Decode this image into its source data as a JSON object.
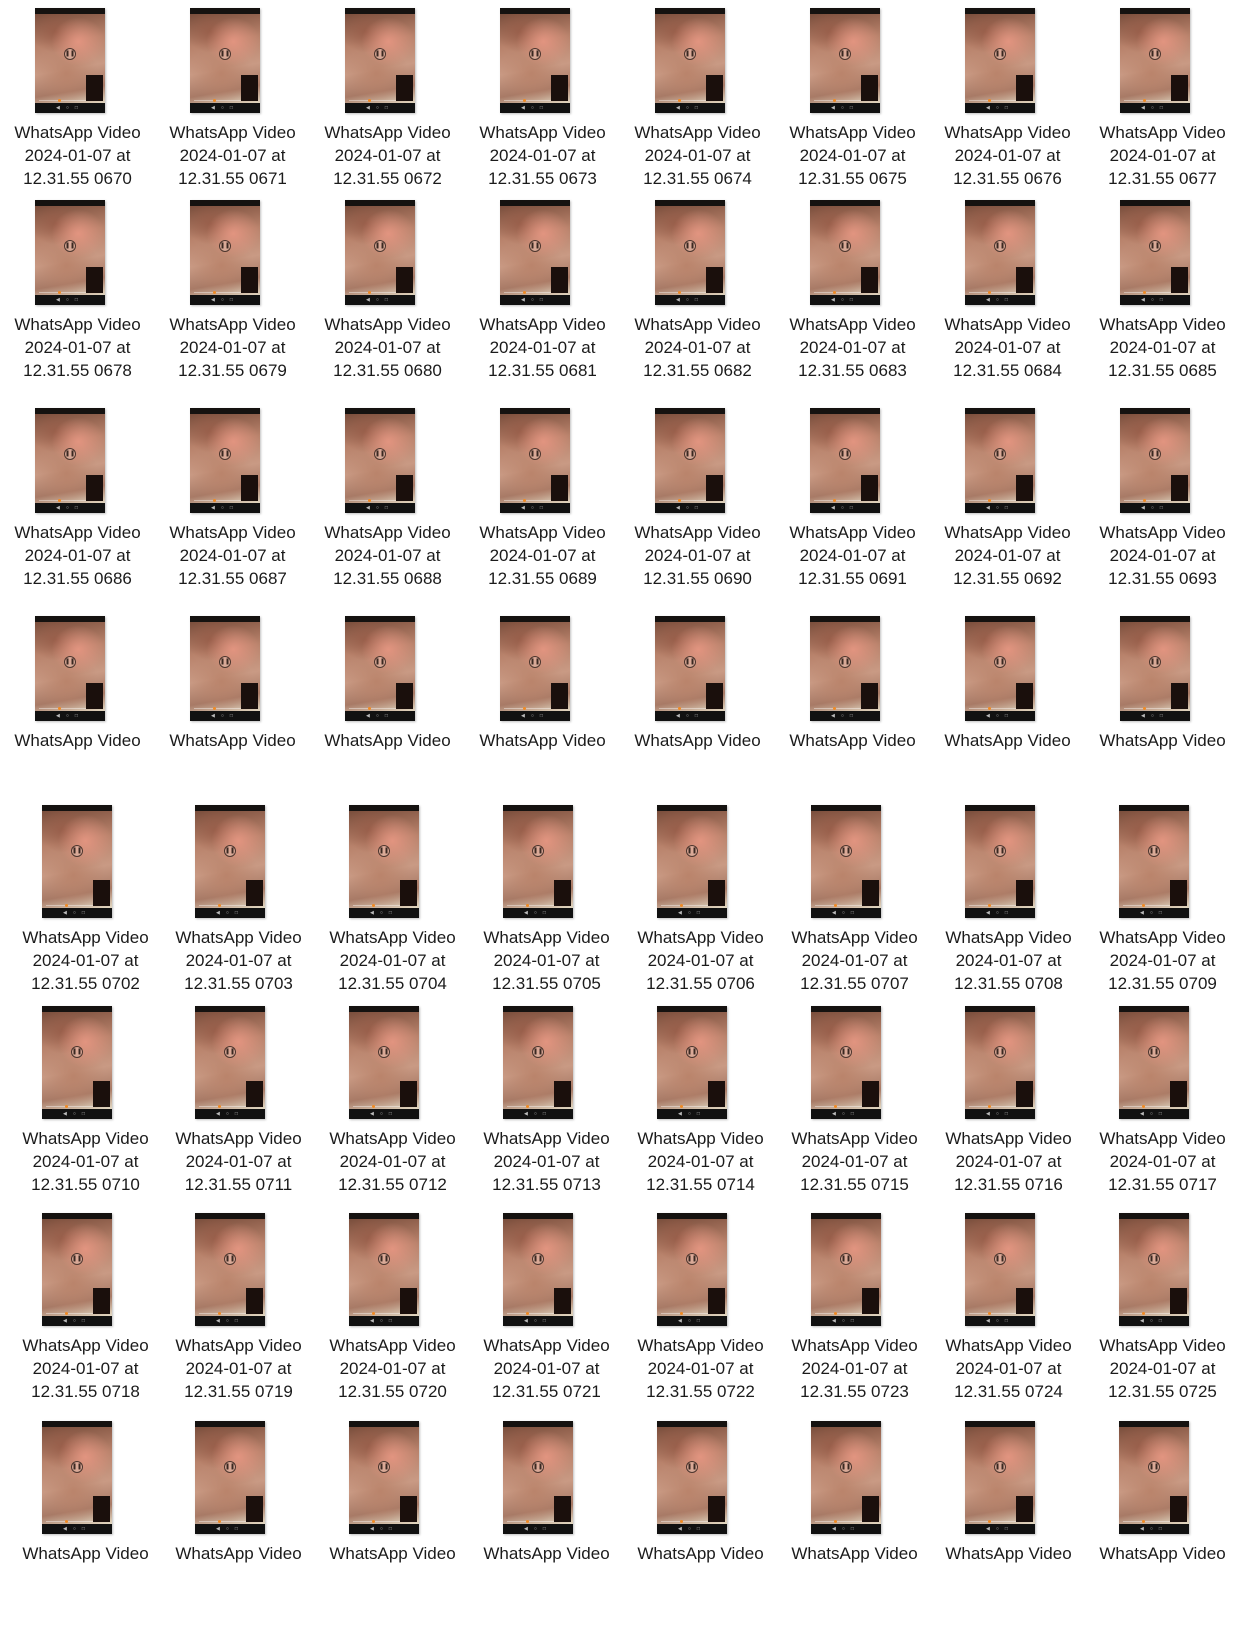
{
  "icon": "video-thumbnail-icon",
  "sections": [
    {
      "rows": [
        {
          "items": [
            [
              "WhatsApp Video",
              "2024-01-07 at",
              "12.31.55 0670"
            ],
            [
              "WhatsApp Video",
              "2024-01-07 at",
              "12.31.55 0671"
            ],
            [
              "WhatsApp Video",
              "2024-01-07 at",
              "12.31.55 0672"
            ],
            [
              "WhatsApp Video",
              "2024-01-07 at",
              "12.31.55 0673"
            ],
            [
              "WhatsApp Video",
              "2024-01-07 at",
              "12.31.55 0674"
            ],
            [
              "WhatsApp Video",
              "2024-01-07 at",
              "12.31.55 0675"
            ],
            [
              "WhatsApp Video",
              "2024-01-07 at",
              "12.31.55 0676"
            ],
            [
              "WhatsApp Video",
              "2024-01-07 at",
              "12.31.55 0677"
            ]
          ]
        },
        {
          "items": [
            [
              "WhatsApp Video",
              "2024-01-07 at",
              "12.31.55 0678"
            ],
            [
              "WhatsApp Video",
              "2024-01-07 at",
              "12.31.55 0679"
            ],
            [
              "WhatsApp Video",
              "2024-01-07 at",
              "12.31.55 0680"
            ],
            [
              "WhatsApp Video",
              "2024-01-07 at",
              "12.31.55 0681"
            ],
            [
              "WhatsApp Video",
              "2024-01-07 at",
              "12.31.55 0682"
            ],
            [
              "WhatsApp Video",
              "2024-01-07 at",
              "12.31.55 0683"
            ],
            [
              "WhatsApp Video",
              "2024-01-07 at",
              "12.31.55 0684"
            ],
            [
              "WhatsApp Video",
              "2024-01-07 at",
              "12.31.55 0685"
            ]
          ]
        },
        {
          "items": [
            [
              "WhatsApp Video",
              "2024-01-07 at",
              "12.31.55 0686"
            ],
            [
              "WhatsApp Video",
              "2024-01-07 at",
              "12.31.55 0687"
            ],
            [
              "WhatsApp Video",
              "2024-01-07 at",
              "12.31.55 0688"
            ],
            [
              "WhatsApp Video",
              "2024-01-07 at",
              "12.31.55 0689"
            ],
            [
              "WhatsApp Video",
              "2024-01-07 at",
              "12.31.55 0690"
            ],
            [
              "WhatsApp Video",
              "2024-01-07 at",
              "12.31.55 0691"
            ],
            [
              "WhatsApp Video",
              "2024-01-07 at",
              "12.31.55 0692"
            ],
            [
              "WhatsApp Video",
              "2024-01-07 at",
              "12.31.55 0693"
            ]
          ]
        },
        {
          "items": [
            [
              "WhatsApp Video"
            ],
            [
              "WhatsApp Video"
            ],
            [
              "WhatsApp Video"
            ],
            [
              "WhatsApp Video"
            ],
            [
              "WhatsApp Video"
            ],
            [
              "WhatsApp Video"
            ],
            [
              "WhatsApp Video"
            ],
            [
              "WhatsApp Video"
            ]
          ]
        }
      ]
    },
    {
      "rows": [
        {
          "items": [
            [
              "WhatsApp Video",
              "2024-01-07 at",
              "12.31.55 0702"
            ],
            [
              "WhatsApp Video",
              "2024-01-07 at",
              "12.31.55 0703"
            ],
            [
              "WhatsApp Video",
              "2024-01-07 at",
              "12.31.55 0704"
            ],
            [
              "WhatsApp Video",
              "2024-01-07 at",
              "12.31.55 0705"
            ],
            [
              "WhatsApp Video",
              "2024-01-07 at",
              "12.31.55 0706"
            ],
            [
              "WhatsApp Video",
              "2024-01-07 at",
              "12.31.55 0707"
            ],
            [
              "WhatsApp Video",
              "2024-01-07 at",
              "12.31.55 0708"
            ],
            [
              "WhatsApp Video",
              "2024-01-07 at",
              "12.31.55 0709"
            ]
          ]
        },
        {
          "items": [
            [
              "WhatsApp Video",
              "2024-01-07 at",
              "12.31.55 0710"
            ],
            [
              "WhatsApp Video",
              "2024-01-07 at",
              "12.31.55 0711"
            ],
            [
              "WhatsApp Video",
              "2024-01-07 at",
              "12.31.55 0712"
            ],
            [
              "WhatsApp Video",
              "2024-01-07 at",
              "12.31.55 0713"
            ],
            [
              "WhatsApp Video",
              "2024-01-07 at",
              "12.31.55 0714"
            ],
            [
              "WhatsApp Video",
              "2024-01-07 at",
              "12.31.55 0715"
            ],
            [
              "WhatsApp Video",
              "2024-01-07 at",
              "12.31.55 0716"
            ],
            [
              "WhatsApp Video",
              "2024-01-07 at",
              "12.31.55 0717"
            ]
          ]
        },
        {
          "items": [
            [
              "WhatsApp Video",
              "2024-01-07 at",
              "12.31.55 0718"
            ],
            [
              "WhatsApp Video",
              "2024-01-07 at",
              "12.31.55 0719"
            ],
            [
              "WhatsApp Video",
              "2024-01-07 at",
              "12.31.55 0720"
            ],
            [
              "WhatsApp Video",
              "2024-01-07 at",
              "12.31.55 0721"
            ],
            [
              "WhatsApp Video",
              "2024-01-07 at",
              "12.31.55 0722"
            ],
            [
              "WhatsApp Video",
              "2024-01-07 at",
              "12.31.55 0723"
            ],
            [
              "WhatsApp Video",
              "2024-01-07 at",
              "12.31.55 0724"
            ],
            [
              "WhatsApp Video",
              "2024-01-07 at",
              "12.31.55 0725"
            ]
          ]
        },
        {
          "items": [
            [
              "WhatsApp Video"
            ],
            [
              "WhatsApp Video"
            ],
            [
              "WhatsApp Video"
            ],
            [
              "WhatsApp Video"
            ],
            [
              "WhatsApp Video"
            ],
            [
              "WhatsApp Video"
            ],
            [
              "WhatsApp Video"
            ],
            [
              "WhatsApp Video"
            ]
          ]
        }
      ]
    }
  ]
}
